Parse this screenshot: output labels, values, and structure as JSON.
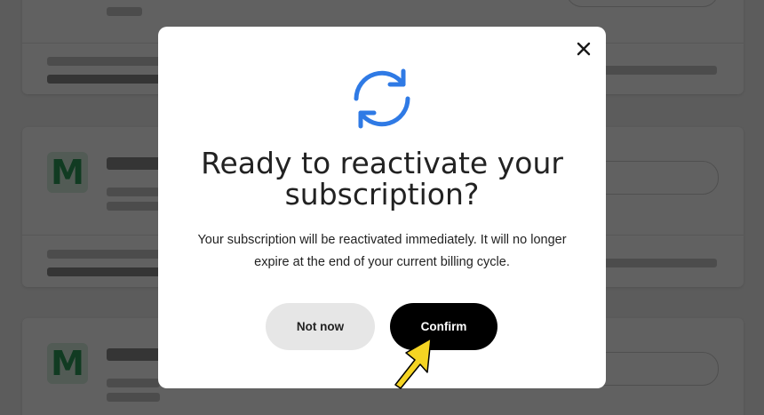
{
  "modal": {
    "title": "Ready to reactivate your subscription?",
    "body": "Your subscription will be reactivated immediately. It will no longer expire at the end of your current billing cycle.",
    "secondary_button_label": "Not now",
    "primary_button_label": "Confirm",
    "close_icon": "close-icon",
    "header_icon": "refresh-icon"
  },
  "background": {
    "card_logo_letter": "M"
  },
  "colors": {
    "accent_blue": "#2f7ae5",
    "primary_button": "#000000",
    "secondary_button": "#e6e6e6",
    "cursor_highlight": "#f5d423"
  }
}
